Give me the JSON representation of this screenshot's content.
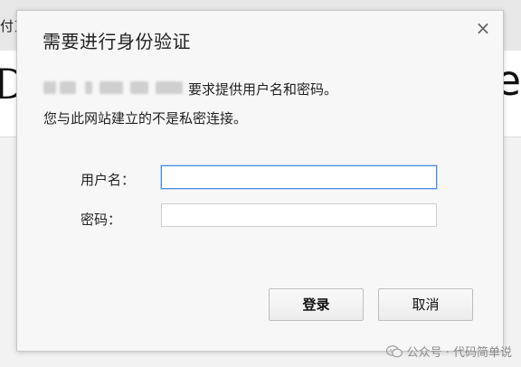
{
  "background": {
    "tab_text": "付東",
    "big_left_glyph": "D",
    "big_right_glyph": "re"
  },
  "dialog": {
    "title": "需要进行身份验证",
    "close_glyph": "×",
    "message_line1": "要求提供用户名和密码。",
    "message_line2": "您与此网站建立的不是私密连接。",
    "username_label": "用户名：",
    "password_label": "密码：",
    "username_value": "",
    "password_value": "",
    "login_button": "登录",
    "cancel_button": "取消"
  },
  "watermark": {
    "text": "公众号 · 代码简单说"
  }
}
